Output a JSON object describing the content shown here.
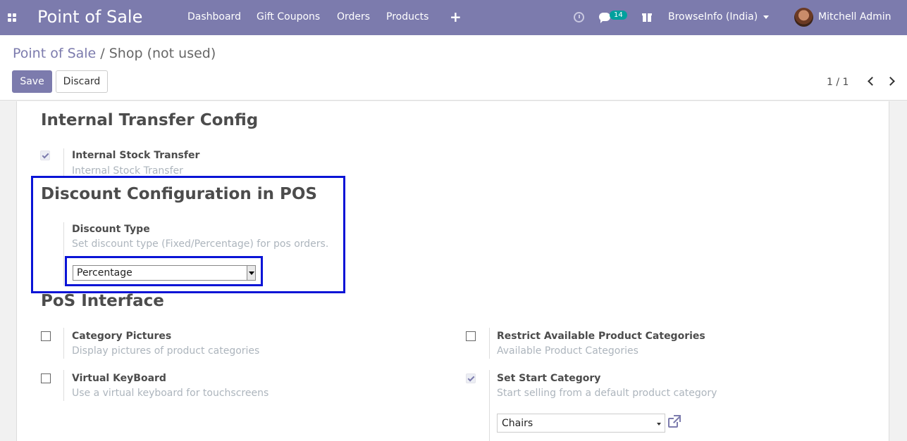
{
  "navbar": {
    "brand": "Point of Sale",
    "menu": [
      "Dashboard",
      "Gift Coupons",
      "Orders",
      "Products"
    ],
    "plus": "+",
    "message_count": "14",
    "company": "BrowseInfo (India)",
    "user": "Mitchell Admin"
  },
  "breadcrumb": {
    "parent": "Point of Sale",
    "separator": "/",
    "current": "Shop (not used)"
  },
  "buttons": {
    "save": "Save",
    "discard": "Discard"
  },
  "pager": {
    "value": "1 / 1"
  },
  "sections": {
    "internal_transfer": {
      "title": "Internal Transfer Config",
      "setting": {
        "label": "Internal Stock Transfer",
        "description": "Internal Stock Transfer",
        "checked": true
      }
    },
    "discount": {
      "title": "Discount Configuration in POS",
      "setting": {
        "label": "Discount Type",
        "description": "Set discount type (Fixed/Percentage) for pos orders.",
        "value": "Percentage"
      }
    },
    "pos_interface": {
      "title": "PoS Interface",
      "settings": [
        {
          "label": "Category Pictures",
          "description": "Display pictures of product categories",
          "checked": false
        },
        {
          "label": "Restrict Available Product Categories",
          "description": "Available Product Categories",
          "checked": false
        },
        {
          "label": "Virtual KeyBoard",
          "description": "Use a virtual keyboard for touchscreens",
          "checked": false
        },
        {
          "label": "Set Start Category",
          "description": "Start selling from a default product category",
          "checked": true,
          "value": "Chairs"
        }
      ]
    }
  },
  "colors": {
    "primary": "#7c7bad",
    "highlight": "#0a14d6",
    "badge": "#00a09d"
  }
}
